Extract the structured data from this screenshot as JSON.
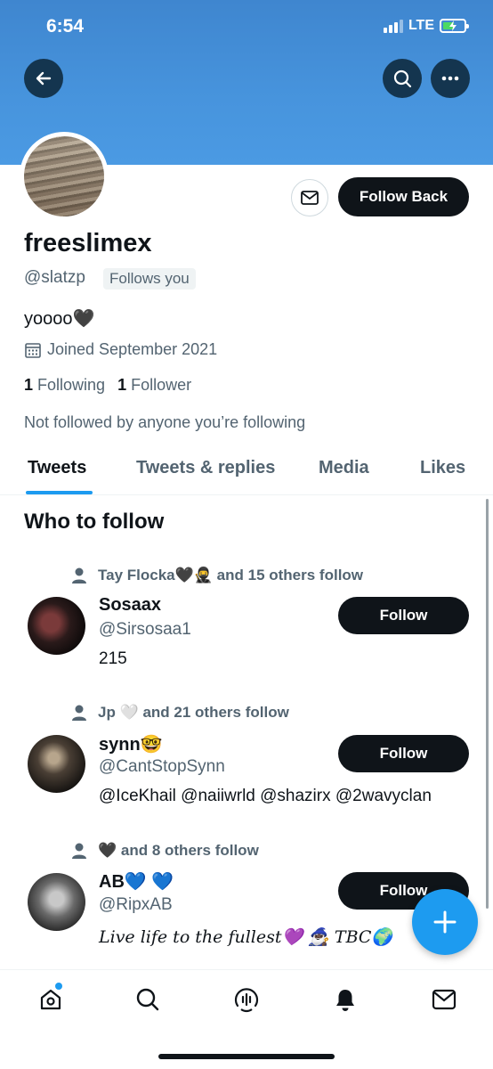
{
  "status_bar": {
    "time": "6:54",
    "network": "LTE"
  },
  "header": {
    "back_icon": "arrow-left-icon",
    "search_icon": "search-icon",
    "more_icon": "more-horizontal-icon"
  },
  "profile": {
    "display_name": "freeslimex",
    "handle": "@slatzp",
    "follows_you": "Follows you",
    "bio": "yoooo🖤",
    "joined": "Joined September 2021",
    "following_count": "1",
    "following_label": "Following",
    "followers_count": "1",
    "followers_label": "Follower",
    "not_followed": "Not followed by anyone you’re following",
    "follow_back_label": "Follow Back"
  },
  "tabs": [
    {
      "label": "Tweets",
      "active": true
    },
    {
      "label": "Tweets & replies",
      "active": false
    },
    {
      "label": "Media",
      "active": false
    },
    {
      "label": "Likes",
      "active": false
    }
  ],
  "who_to_follow": {
    "title": "Who to follow",
    "items": [
      {
        "social": "Tay Flocka🖤🥷 and 15 others follow",
        "name": "Sosaax",
        "handle": "@Sirsosaa1",
        "bio": "215",
        "button": "Follow"
      },
      {
        "social": "Jp 🤍 and 21 others follow",
        "name": "synn🤓",
        "handle": "@CantStopSynn",
        "bio": "@IceKhail @naiiwrld @shazirx @2wavyclan",
        "button": "Follow"
      },
      {
        "social": "🖤 and 8 others follow",
        "name": "AB💙 💙",
        "handle": "@RipxAB",
        "bio": "𝐿𝑖𝑣𝑒 𝑙𝑖𝑓𝑒 𝑡𝑜 𝑡ℎ𝑒 𝑓𝑢𝑙𝑙𝑒𝑠𝑡💜 🧙🏿‍♂️ TBC🌍",
        "button": "Follow"
      }
    ]
  },
  "bottom_nav": [
    "home-icon",
    "search-icon",
    "spaces-icon",
    "notifications-icon",
    "messages-icon"
  ],
  "colors": {
    "accent": "#1d9bf0",
    "banner": "#4794dd",
    "text": "#0f1419",
    "secondary": "#536471"
  }
}
